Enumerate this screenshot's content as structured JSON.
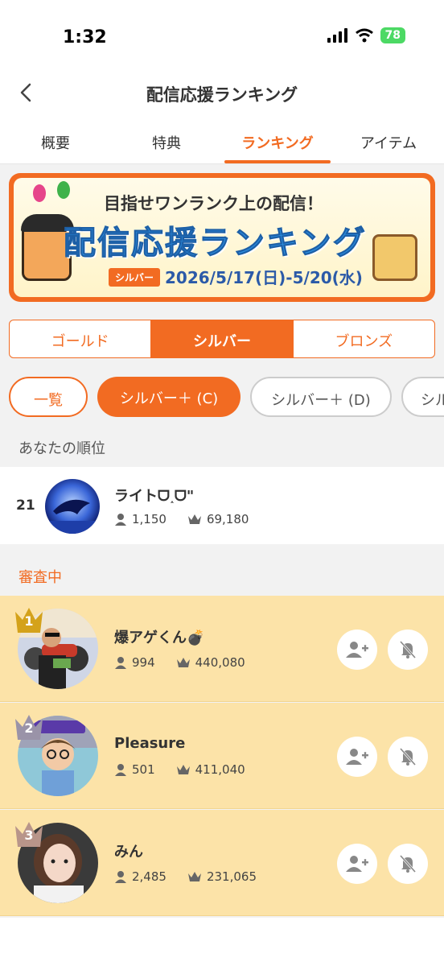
{
  "status": {
    "time": "1:32",
    "battery": "78"
  },
  "nav": {
    "title": "配信応援ランキング"
  },
  "tabs": [
    {
      "label": "概要"
    },
    {
      "label": "特典"
    },
    {
      "label": "ランキング"
    },
    {
      "label": "アイテム"
    }
  ],
  "banner": {
    "subtitle": "目指せワンランク上の配信！",
    "title": "配信応援ランキング",
    "badge": "シルバー",
    "dates": "2026/5/17(日)-5/20(水)"
  },
  "segments": [
    {
      "label": "ゴールド"
    },
    {
      "label": "シルバー"
    },
    {
      "label": "ブロンズ"
    }
  ],
  "chips": [
    {
      "label": "一覧"
    },
    {
      "label": "シルバー＋ (C)"
    },
    {
      "label": "シルバー＋ (D)"
    },
    {
      "label": "シル"
    }
  ],
  "sections": {
    "your_rank": "あなたの順位",
    "review": "審査中"
  },
  "me": {
    "rank": "21",
    "name": "ライトᗜ˰ᗜ\"",
    "fans": "1,150",
    "points": "69,180"
  },
  "ranking": [
    {
      "rank": "1",
      "name": "爆アゲくん💣",
      "fans": "994",
      "points": "440,080"
    },
    {
      "rank": "2",
      "name": "Pleasure",
      "fans": "501",
      "points": "411,040"
    },
    {
      "rank": "3",
      "name": "みん",
      "fans": "2,485",
      "points": "231,065"
    }
  ],
  "colors": {
    "accent": "#f26b22",
    "highlight_row": "#fce3a8",
    "gold": "#d4a21a",
    "silver": "#9a93a8",
    "bronze": "#b8958a"
  },
  "icons": [
    "back-chevron-icon",
    "person-icon",
    "crown-icon",
    "add-friend-icon",
    "bell-off-icon"
  ]
}
